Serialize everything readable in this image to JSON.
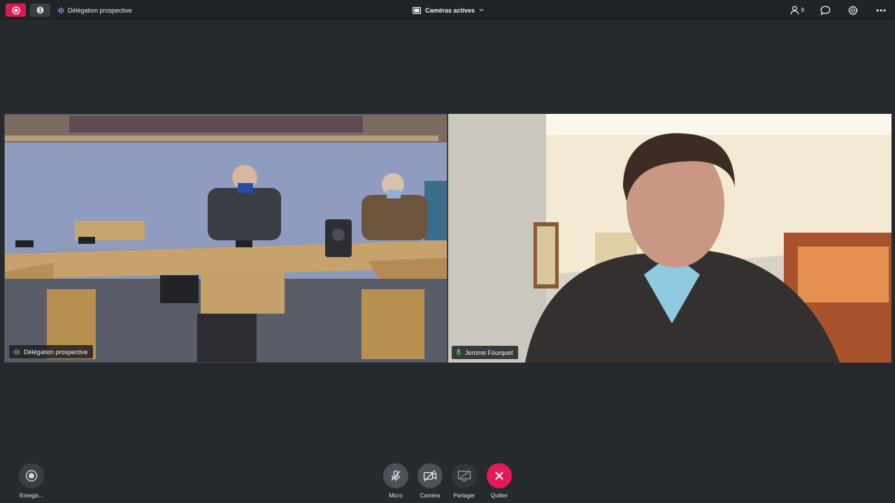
{
  "topbar": {
    "room_name": "Délégation prospective",
    "layout_label": "Caméras actives",
    "participants_count": "8",
    "accent": "#d81b4f"
  },
  "tiles": [
    {
      "name": "Délégation prospective",
      "indicator": "audio-bars-icon"
    },
    {
      "name": "Jerome Fourquet",
      "indicator": "microphone-icon"
    }
  ],
  "controls": {
    "record_label": "Enregis...",
    "mic_label": "Micro",
    "camera_label": "Caméra",
    "share_label": "Partager",
    "quit_label": "Quitter",
    "quit_color": "#e5195a"
  }
}
